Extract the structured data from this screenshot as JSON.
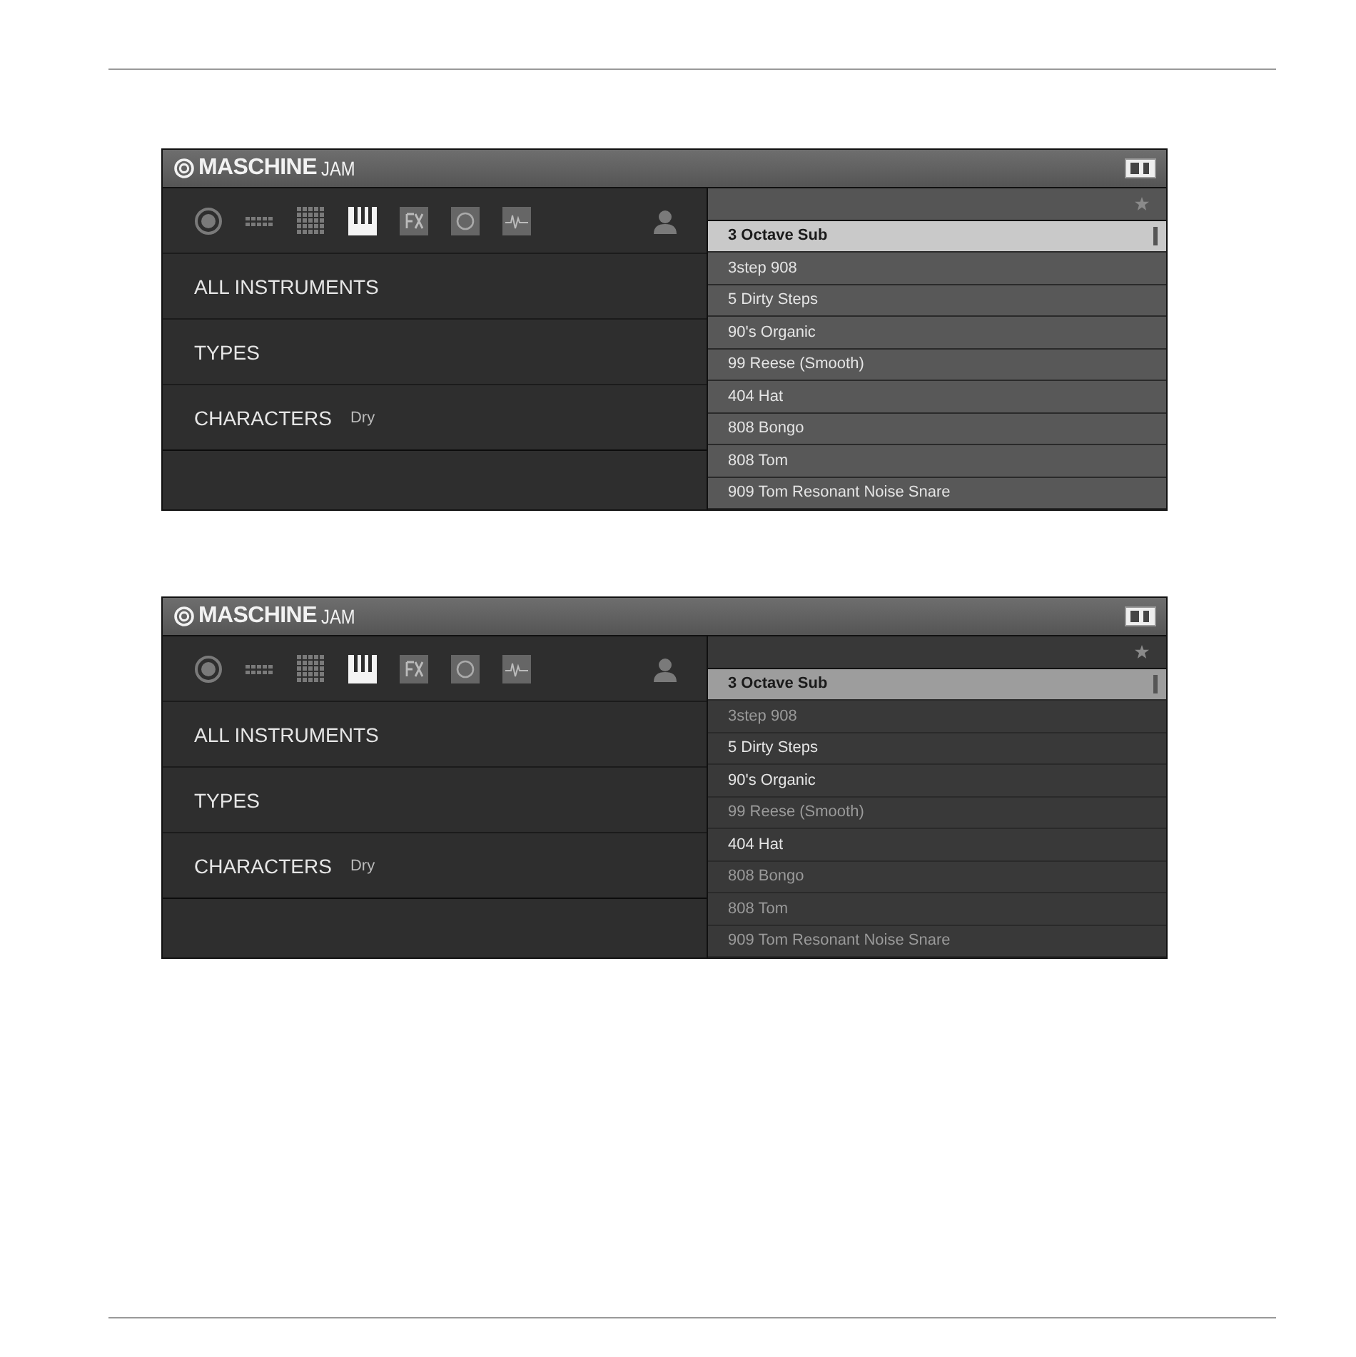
{
  "screens": [
    {
      "filtered": false,
      "header": {
        "brand": "MASCHINE",
        "suffix": "JAM"
      },
      "filter_icons": [
        {
          "kind": "target",
          "selected": false
        },
        {
          "kind": "steps",
          "selected": false
        },
        {
          "kind": "grid",
          "selected": false
        },
        {
          "kind": "keys",
          "selected": true
        },
        {
          "kind": "fx",
          "selected": false
        },
        {
          "kind": "loop",
          "selected": false
        },
        {
          "kind": "wave",
          "selected": false
        }
      ],
      "categories": [
        {
          "label": "ALL INSTRUMENTS"
        },
        {
          "label": "TYPES"
        },
        {
          "label": "CHARACTERS",
          "value": "Dry"
        }
      ],
      "results": [
        {
          "name": "3 Octave Sub",
          "selected": true,
          "dimmed": false
        },
        {
          "name": "3step 908",
          "selected": false,
          "dimmed": false
        },
        {
          "name": "5 Dirty Steps",
          "selected": false,
          "dimmed": false
        },
        {
          "name": "90's Organic",
          "selected": false,
          "dimmed": false
        },
        {
          "name": "99 Reese (Smooth)",
          "selected": false,
          "dimmed": false
        },
        {
          "name": "404 Hat",
          "selected": false,
          "dimmed": false
        },
        {
          "name": "808 Bongo",
          "selected": false,
          "dimmed": false
        },
        {
          "name": "808 Tom",
          "selected": false,
          "dimmed": false
        },
        {
          "name": "909 Tom Resonant Noise Snare",
          "selected": false,
          "dimmed": false
        }
      ]
    },
    {
      "filtered": true,
      "header": {
        "brand": "MASCHINE",
        "suffix": "JAM"
      },
      "filter_icons": [
        {
          "kind": "target",
          "selected": false
        },
        {
          "kind": "steps",
          "selected": false
        },
        {
          "kind": "grid",
          "selected": false
        },
        {
          "kind": "keys",
          "selected": true
        },
        {
          "kind": "fx",
          "selected": false
        },
        {
          "kind": "loop",
          "selected": false
        },
        {
          "kind": "wave",
          "selected": false
        }
      ],
      "categories": [
        {
          "label": "ALL INSTRUMENTS"
        },
        {
          "label": "TYPES"
        },
        {
          "label": "CHARACTERS",
          "value": "Dry"
        }
      ],
      "results": [
        {
          "name": "3 Octave Sub",
          "selected": true,
          "dimmed": false
        },
        {
          "name": "3step 908",
          "selected": false,
          "dimmed": true
        },
        {
          "name": "5 Dirty Steps",
          "selected": false,
          "dimmed": false
        },
        {
          "name": "90's Organic",
          "selected": false,
          "dimmed": false
        },
        {
          "name": "99 Reese (Smooth)",
          "selected": false,
          "dimmed": true
        },
        {
          "name": "404 Hat",
          "selected": false,
          "dimmed": false
        },
        {
          "name": "808 Bongo",
          "selected": false,
          "dimmed": true
        },
        {
          "name": "808 Tom",
          "selected": false,
          "dimmed": true
        },
        {
          "name": "909 Tom Resonant Noise Snare",
          "selected": false,
          "dimmed": true
        }
      ]
    }
  ]
}
